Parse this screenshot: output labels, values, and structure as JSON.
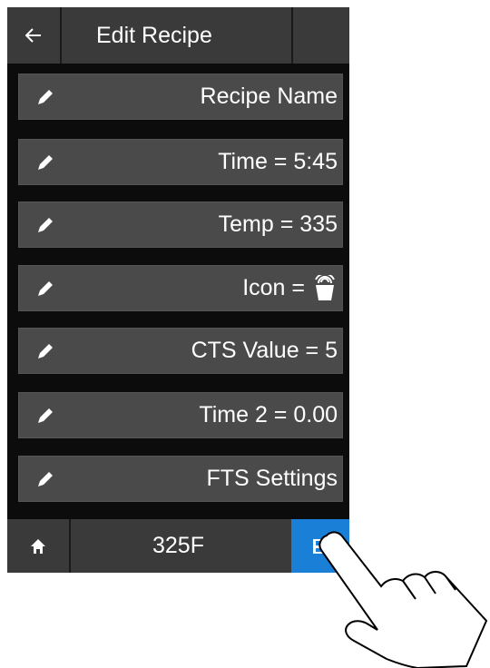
{
  "header": {
    "back_icon": "arrow-left-icon",
    "title": "Edit Recipe"
  },
  "rows": [
    {
      "label": "Recipe Name",
      "icon": "pencil-icon"
    },
    {
      "label": "Time = 5:45",
      "icon": "pencil-icon"
    },
    {
      "label": "Temp =  335",
      "icon": "pencil-icon"
    },
    {
      "label": "Icon =",
      "icon": "pencil-icon",
      "value_icon": "basket-icon"
    },
    {
      "label": "CTS Value = 5",
      "icon": "pencil-icon"
    },
    {
      "label": "Time 2 = 0.00",
      "icon": "pencil-icon"
    },
    {
      "label": "FTS Settings",
      "icon": "pencil-icon"
    }
  ],
  "footer": {
    "home_icon": "home-icon",
    "temperature": "325F",
    "save_icon": "save-icon"
  },
  "colors": {
    "screen_bg": "#0c0c0c",
    "bar_bg": "#3a3a3a",
    "row_bg": "#4a4a4a",
    "accent": "#1a7fd6",
    "text": "#ffffff"
  }
}
